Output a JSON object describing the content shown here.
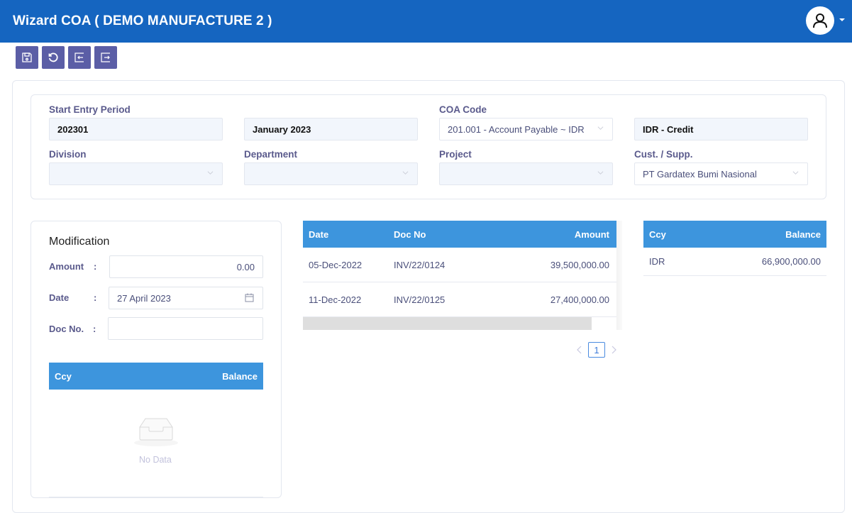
{
  "header": {
    "title": "Wizard COA ( DEMO MANUFACTURE 2 )",
    "user_icon": "user-icon"
  },
  "toolbar": {
    "buttons": [
      {
        "name": "save",
        "icon": "save-icon"
      },
      {
        "name": "reset",
        "icon": "refresh-icon"
      },
      {
        "name": "back",
        "icon": "exit-left-icon"
      },
      {
        "name": "next",
        "icon": "exit-right-icon"
      }
    ]
  },
  "filters": {
    "start_entry_period": {
      "label": "Start Entry Period",
      "code": "202301",
      "name": "January 2023"
    },
    "coa_code": {
      "label": "COA Code",
      "value": "201.001 - Account Payable ~ IDR",
      "type": "IDR - Credit"
    },
    "division": {
      "label": "Division",
      "value": ""
    },
    "department": {
      "label": "Department",
      "value": ""
    },
    "project": {
      "label": "Project",
      "value": ""
    },
    "cust_supp": {
      "label": "Cust. / Supp.",
      "value": "PT Gardatex Bumi Nasional"
    }
  },
  "modification": {
    "title": "Modification",
    "amount": {
      "label": "Amount",
      "value": "0.00"
    },
    "date": {
      "label": "Date",
      "value": "27 April 2023"
    },
    "doc_no": {
      "label": "Doc No.",
      "value": ""
    },
    "colon": ":",
    "table": {
      "columns": [
        "Ccy",
        "Balance"
      ],
      "empty_text": "No Data"
    }
  },
  "documents": {
    "columns": [
      "Date",
      "Doc No",
      "Amount"
    ],
    "rows": [
      {
        "date": "05-Dec-2022",
        "doc_no": "INV/22/0124",
        "amount": "39,500,000.00"
      },
      {
        "date": "11-Dec-2022",
        "doc_no": "INV/22/0125",
        "amount": "27,400,000.00"
      }
    ],
    "pagination": {
      "current_page": "1"
    }
  },
  "balance": {
    "columns": [
      "Ccy",
      "Balance"
    ],
    "rows": [
      {
        "ccy": "IDR",
        "balance": "66,900,000.00"
      }
    ]
  },
  "colors": {
    "header_bg": "#1565c0",
    "toolbar_btn": "#5b5ea6",
    "table_header": "#3d95dd"
  }
}
